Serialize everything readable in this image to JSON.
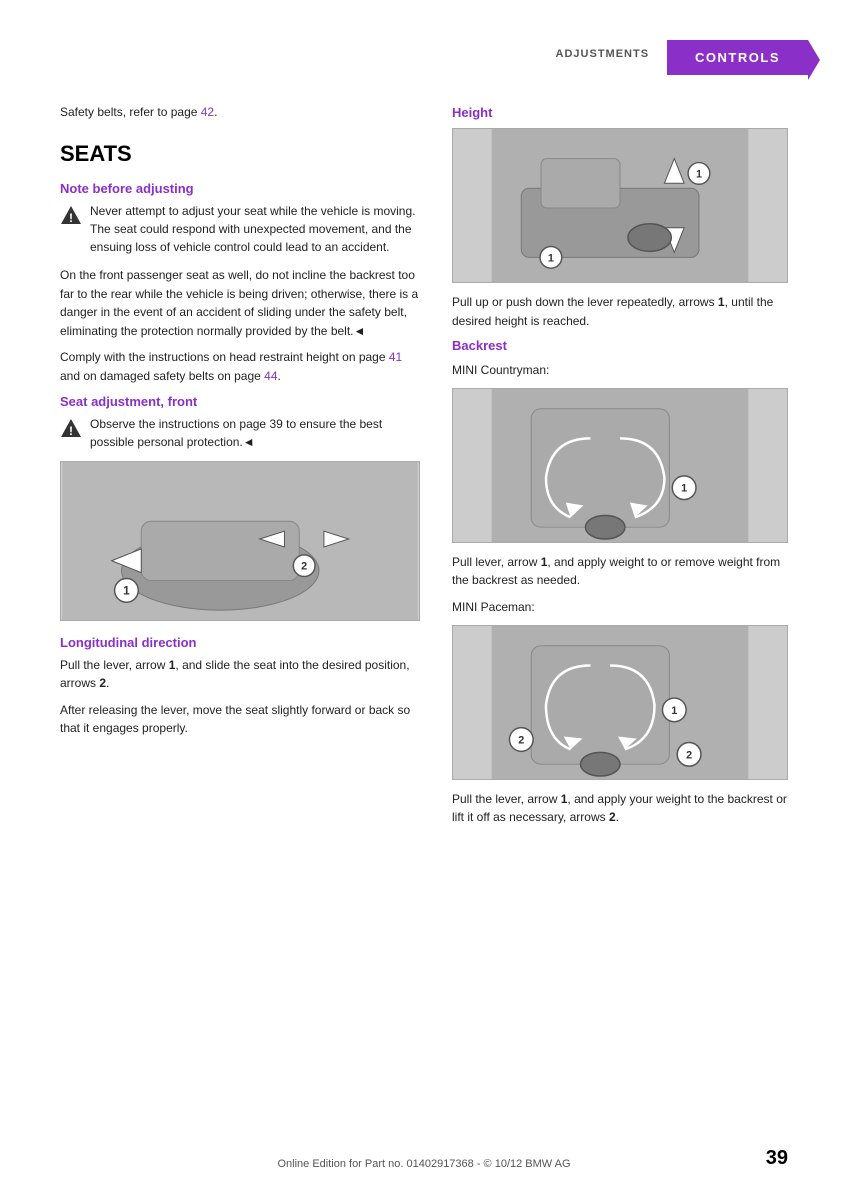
{
  "header": {
    "tab_adjustments": "ADJUSTMENTS",
    "tab_controls": "CONTROLS"
  },
  "safety_belts": {
    "text": "Safety belts, refer to page ",
    "link_text": "42",
    "link_page": "42"
  },
  "seats": {
    "title": "SEATS",
    "note_heading": "Note before adjusting",
    "note_warning_text": "Never attempt to adjust your seat while the vehicle is moving. The seat could respond with unexpected movement, and the ensuing loss of vehicle control could lead to an accident.",
    "note_body1": "On the front passenger seat as well, do not incline the backrest too far to the rear while the vehicle is being driven; otherwise, there is a danger in the event of an accident of sliding under the safety belt, eliminating the protection normally provided by the belt.◄",
    "note_body2_prefix": "Comply with the instructions on head restraint height on page ",
    "note_body2_link1": "41",
    "note_body2_mid": " and on damaged safety belts on page ",
    "note_body2_link2": "44",
    "note_body2_suffix": ".",
    "seat_adj_heading": "Seat adjustment, front",
    "seat_adj_warning": "Observe the instructions on page 39 to ensure the best possible personal protection.◄",
    "seat_adj_warning_link": "39",
    "longitudinal_heading": "Longitudinal direction",
    "longitudinal_body1_prefix": "Pull the lever, arrow ",
    "longitudinal_body1_bold": "1",
    "longitudinal_body1_mid": ", and slide the seat into the desired position, arrows ",
    "longitudinal_body1_bold2": "2",
    "longitudinal_body1_suffix": ".",
    "longitudinal_body2": "After releasing the lever, move the seat slightly forward or back so that it engages properly."
  },
  "right_col": {
    "height_heading": "Height",
    "height_body_prefix": "Pull up or push down the lever repeatedly, arrows ",
    "height_body_bold": "1",
    "height_body_suffix": ", until the desired height is reached.",
    "backrest_heading": "Backrest",
    "backrest_mini_countryman": "MINI Countryman:",
    "backrest_body1_prefix": "Pull lever, arrow ",
    "backrest_body1_bold": "1",
    "backrest_body1_suffix": ", and apply weight to or remove weight from the backrest as needed.",
    "backrest_mini_paceman": "MINI Paceman:",
    "backrest_body2_prefix": "Pull the lever, arrow ",
    "backrest_body2_bold1": "1",
    "backrest_body2_mid": ", and apply your weight to the backrest or lift it off as necessary, arrows ",
    "backrest_body2_bold2": "2",
    "backrest_body2_suffix": "."
  },
  "footer": {
    "text": "Online Edition for Part no. 01402917368 - © 10/12 BMW AG",
    "page_number": "39"
  }
}
